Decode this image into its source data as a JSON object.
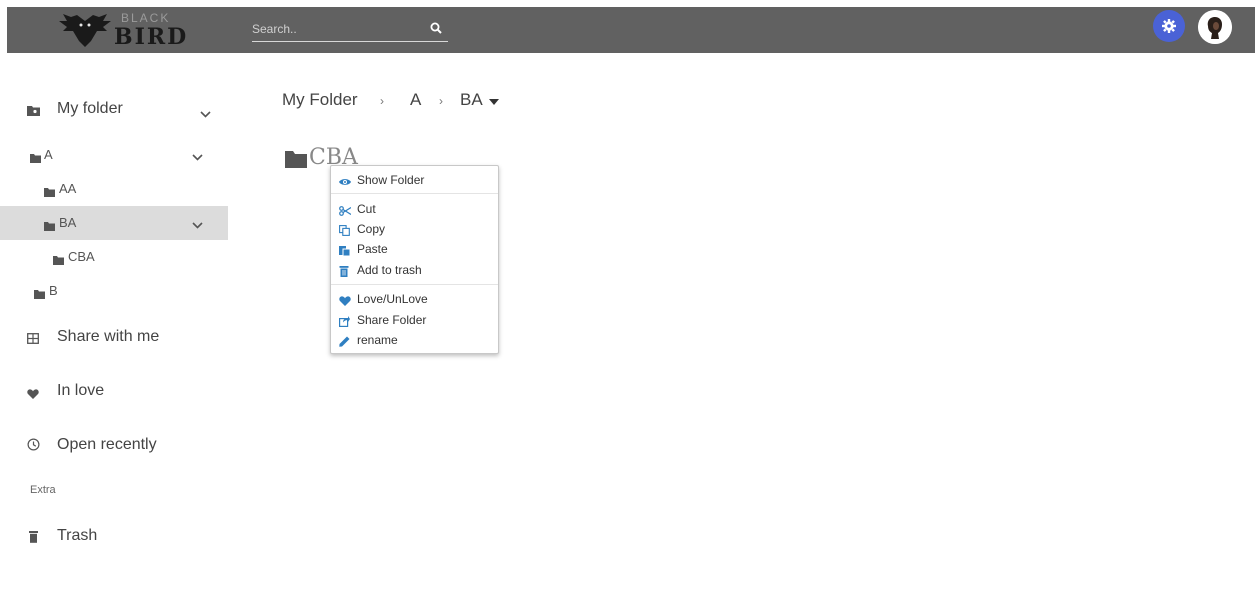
{
  "header": {
    "logo_top": "BLACK",
    "logo_bottom": "BIRD",
    "search_placeholder": "Search.."
  },
  "sidebar": {
    "my_folder": "My folder",
    "tree": [
      {
        "label": "A",
        "level": 1,
        "expandable": true,
        "active": false
      },
      {
        "label": "AA",
        "level": 2,
        "expandable": false,
        "active": false
      },
      {
        "label": "BA",
        "level": 2,
        "expandable": true,
        "active": true
      },
      {
        "label": "CBA",
        "level": 3,
        "expandable": false,
        "active": false
      },
      {
        "label": "B",
        "level": 1,
        "expandable": false,
        "active": false
      }
    ],
    "share_with_me": "Share with me",
    "in_love": "In love",
    "open_recently": "Open recently",
    "extra": "Extra",
    "trash": "Trash"
  },
  "breadcrumb": {
    "root": "My Folder",
    "sep": "›",
    "level1": "A",
    "level2": "BA"
  },
  "folder": {
    "name": "CBA"
  },
  "context_menu": {
    "show_folder": "Show Folder",
    "cut": "Cut",
    "copy": "Copy",
    "paste": "Paste",
    "add_to_trash": "Add to trash",
    "love": "Love/UnLove",
    "share_folder": "Share Folder",
    "rename": "rename"
  },
  "colors": {
    "topbar": "#616161",
    "accent": "#4a62d6",
    "menu_icon": "#2f7fc1",
    "active_row": "#dcdcdc"
  }
}
